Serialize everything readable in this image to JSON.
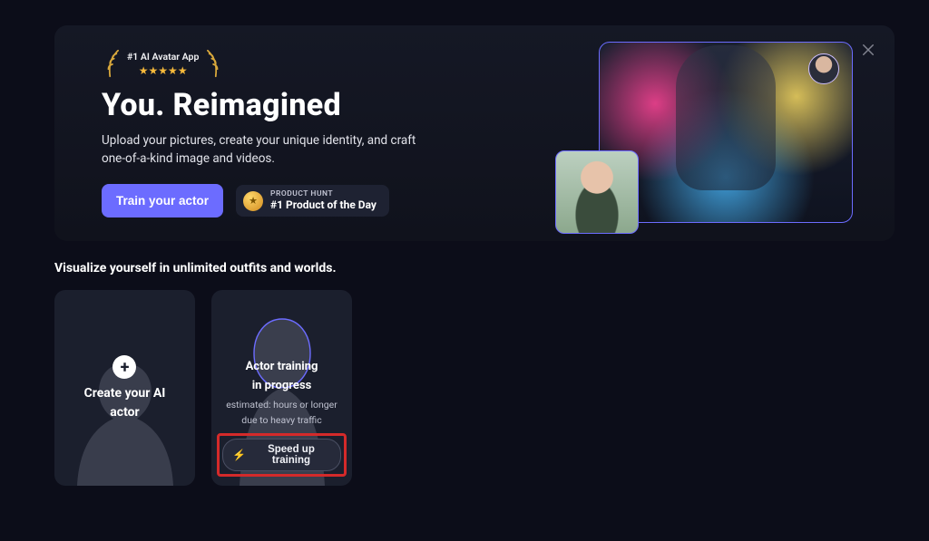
{
  "hero": {
    "badge_tag": "#1 AI Avatar App",
    "title": "You. Reimagined",
    "subtitle": "Upload your pictures, create your unique identity, and craft one-of-a-kind image and videos.",
    "train_button": "Train your actor",
    "product_hunt": {
      "top": "PRODUCT HUNT",
      "bottom": "#1 Product of the Day"
    }
  },
  "section_title": "Visualize yourself in unlimited outfits and worlds.",
  "cards": {
    "create": {
      "title_line1": "Create your AI",
      "title_line2": "actor"
    },
    "training": {
      "title_line1": "Actor training",
      "title_line2": "in progress",
      "sub_line1": "estimated: hours or longer",
      "sub_line2": "due to heavy traffic",
      "speed_button": "Speed up training"
    }
  }
}
